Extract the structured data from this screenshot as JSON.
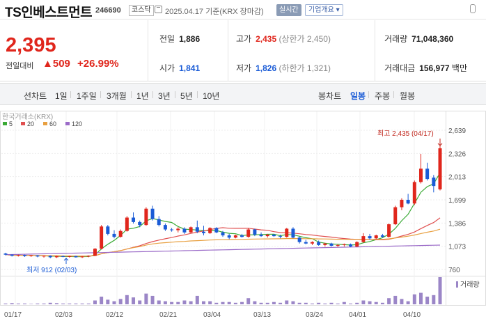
{
  "header": {
    "stock_name": "TS인베스트먼트",
    "stock_code": "246690",
    "market": "코스닥",
    "date_text": "2025.04.17 기준(KRX 장마감)",
    "realtime_label": "실시간",
    "company_info_label": "기업개요 ▾"
  },
  "quote": {
    "price": "2,395",
    "change_label": "전일대비",
    "change_value": "▲509",
    "change_pct": "+26.99%",
    "prev_close_label": "전일",
    "prev_close": "1,886",
    "open_label": "시가",
    "open": "1,841",
    "high_label": "고가",
    "high": "2,435",
    "upper_limit": "(상한가 2,450)",
    "low_label": "저가",
    "low": "1,826",
    "lower_limit": "(하한가 1,321)",
    "volume_label": "거래량",
    "volume": "71,048,360",
    "amount_label": "거래대금",
    "amount": "156,977",
    "amount_unit": "백만"
  },
  "tabs": {
    "line_chart_label": "선차트",
    "periods": [
      "1일",
      "1주일",
      "3개월",
      "1년",
      "3년",
      "5년",
      "10년"
    ],
    "candle_chart_label": "봉차트",
    "candle_periods": [
      "일봉",
      "주봉",
      "월봉"
    ],
    "active_candle": "일봉"
  },
  "chart_data": {
    "type": "candlestick",
    "source_label": "한국거래소(KRX)",
    "legend": [
      {
        "name": "5",
        "color": "#3aaa35"
      },
      {
        "name": "20",
        "color": "#e05050"
      },
      {
        "name": "60",
        "color": "#e8a040"
      },
      {
        "name": "120",
        "color": "#9b6bc8"
      }
    ],
    "y_ticks": [
      "2,639",
      "2,326",
      "2,013",
      "1,699",
      "1,386",
      "1,073",
      "760"
    ],
    "ylim": [
      760,
      2639
    ],
    "x_ticks": [
      "01/17",
      "02/03",
      "02/12",
      "02/21",
      "03/04",
      "03/13",
      "03/24",
      "04/01",
      "04/10"
    ],
    "max_annotation": "최고 2,435 (04/17)",
    "min_annotation": "최저 912 (02/03)",
    "volume_label": "거래량",
    "up_color": "#e0261c",
    "down_color": "#1a5bd6",
    "candles": [
      [
        975,
        985,
        950,
        960
      ],
      [
        960,
        965,
        935,
        945
      ],
      [
        945,
        960,
        935,
        955
      ],
      [
        955,
        960,
        930,
        940
      ],
      [
        940,
        955,
        930,
        950
      ],
      [
        950,
        955,
        925,
        935
      ],
      [
        935,
        950,
        920,
        945
      ],
      [
        945,
        950,
        912,
        925
      ],
      [
        925,
        945,
        915,
        940
      ],
      [
        940,
        950,
        925,
        930
      ],
      [
        930,
        945,
        920,
        940
      ],
      [
        940,
        945,
        920,
        925
      ],
      [
        925,
        940,
        915,
        935
      ],
      [
        935,
        950,
        925,
        945
      ],
      [
        945,
        1050,
        940,
        1040
      ],
      [
        1040,
        1360,
        1030,
        1340
      ],
      [
        1340,
        1360,
        1220,
        1240
      ],
      [
        1240,
        1290,
        1180,
        1200
      ],
      [
        1200,
        1300,
        1190,
        1280
      ],
      [
        1280,
        1480,
        1270,
        1460
      ],
      [
        1460,
        1530,
        1380,
        1400
      ],
      [
        1400,
        1420,
        1330,
        1360
      ],
      [
        1360,
        1600,
        1350,
        1580
      ],
      [
        1580,
        1620,
        1420,
        1440
      ],
      [
        1440,
        1480,
        1340,
        1360
      ],
      [
        1360,
        1380,
        1280,
        1300
      ],
      [
        1300,
        1320,
        1270,
        1290
      ],
      [
        1290,
        1330,
        1260,
        1310
      ],
      [
        1310,
        1330,
        1240,
        1260
      ],
      [
        1260,
        1340,
        1250,
        1330
      ],
      [
        1330,
        1420,
        1250,
        1270
      ],
      [
        1270,
        1350,
        1220,
        1250
      ],
      [
        1250,
        1330,
        1240,
        1320
      ],
      [
        1320,
        1330,
        1250,
        1260
      ],
      [
        1260,
        1280,
        1200,
        1220
      ],
      [
        1220,
        1240,
        1170,
        1190
      ],
      [
        1190,
        1230,
        1180,
        1220
      ],
      [
        1220,
        1240,
        1190,
        1200
      ],
      [
        1200,
        1320,
        1190,
        1300
      ],
      [
        1300,
        1310,
        1210,
        1230
      ],
      [
        1230,
        1260,
        1200,
        1210
      ],
      [
        1210,
        1240,
        1190,
        1230
      ],
      [
        1230,
        1240,
        1200,
        1210
      ],
      [
        1210,
        1230,
        1180,
        1200
      ],
      [
        1200,
        1320,
        1190,
        1310
      ],
      [
        1310,
        1330,
        1180,
        1190
      ],
      [
        1190,
        1200,
        1110,
        1130
      ],
      [
        1130,
        1160,
        1100,
        1110
      ],
      [
        1110,
        1140,
        1090,
        1130
      ],
      [
        1130,
        1150,
        1080,
        1090
      ],
      [
        1090,
        1120,
        1070,
        1110
      ],
      [
        1110,
        1120,
        1070,
        1080
      ],
      [
        1080,
        1100,
        1060,
        1090
      ],
      [
        1090,
        1110,
        1070,
        1100
      ],
      [
        1100,
        1110,
        1060,
        1070
      ],
      [
        1070,
        1140,
        1060,
        1130
      ],
      [
        1130,
        1250,
        1120,
        1210
      ],
      [
        1210,
        1240,
        1160,
        1180
      ],
      [
        1180,
        1230,
        1170,
        1220
      ],
      [
        1220,
        1240,
        1190,
        1200
      ],
      [
        1200,
        1380,
        1190,
        1370
      ],
      [
        1370,
        1620,
        1360,
        1600
      ],
      [
        1600,
        1720,
        1560,
        1700
      ],
      [
        1700,
        1780,
        1640,
        1650
      ],
      [
        1650,
        1960,
        1630,
        1940
      ],
      [
        1940,
        2320,
        1920,
        2120
      ],
      [
        2120,
        2200,
        1960,
        1980
      ],
      [
        2000,
        2035,
        1800,
        1886
      ],
      [
        1841,
        2435,
        1826,
        2395
      ]
    ],
    "volumes": [
      2,
      3,
      2,
      2,
      1,
      2,
      2,
      4,
      3,
      2,
      2,
      2,
      2,
      2,
      10,
      20,
      12,
      8,
      14,
      24,
      18,
      10,
      28,
      22,
      10,
      8,
      6,
      6,
      10,
      8,
      22,
      8,
      8,
      4,
      6,
      6,
      4,
      6,
      16,
      8,
      4,
      4,
      6,
      4,
      10,
      8,
      4,
      4,
      2,
      4,
      2,
      4,
      2,
      6,
      2,
      4,
      10,
      8,
      6,
      4,
      16,
      22,
      14,
      8,
      26,
      30,
      20,
      24,
      71
    ]
  }
}
